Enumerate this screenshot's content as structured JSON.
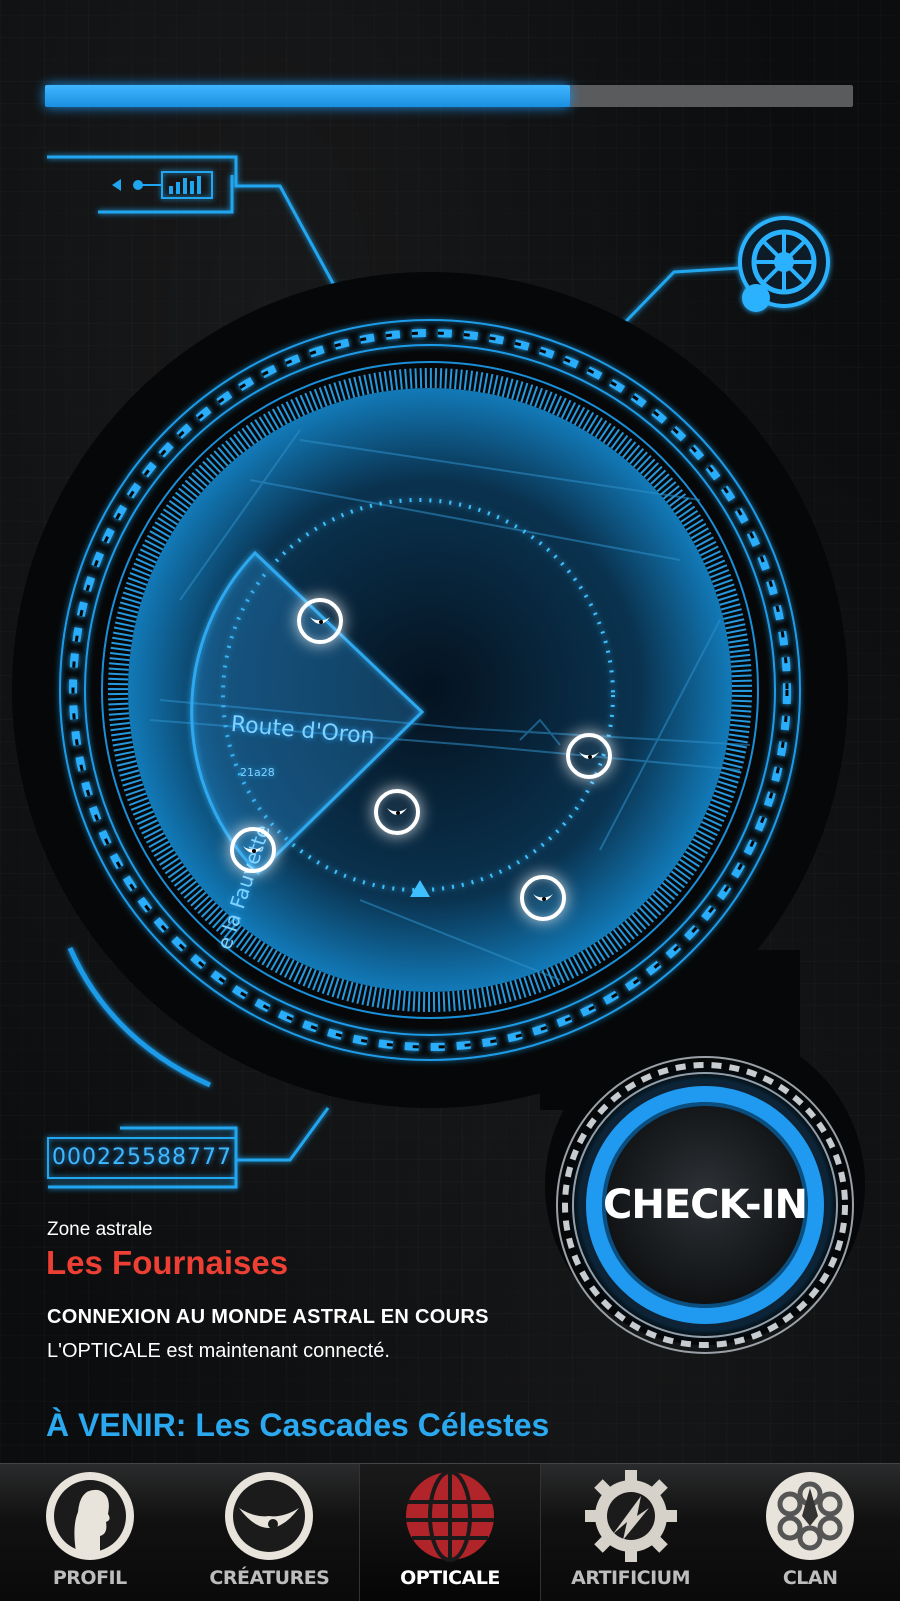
{
  "progress": {
    "value": 0.65
  },
  "map": {
    "road_primary": "Route d'Oron",
    "road_number": "21a28",
    "road_secondary": "e la Fauvette"
  },
  "id_number": "000225588777",
  "zone": {
    "label": "Zone astrale",
    "name": "Les Fournaises"
  },
  "status": {
    "title": "CONNEXION AU MONDE ASTRAL EN COURS",
    "text": "L'OPTICALE est maintenant connecté."
  },
  "upcoming": "À VENIR: Les Cascades Célestes",
  "checkin": {
    "label": "CHECK-IN"
  },
  "tabs": [
    {
      "label": "PROFIL",
      "icon": "profile-icon"
    },
    {
      "label": "CRÉATURES",
      "icon": "creature-eye-icon"
    },
    {
      "label": "OPTICALE",
      "icon": "globe-icon",
      "active": true
    },
    {
      "label": "ARTIFICIUM",
      "icon": "gear-icon"
    },
    {
      "label": "CLAN",
      "icon": "clan-icon"
    }
  ],
  "colors": {
    "accent": "#1f9af0",
    "zone_name": "#ee3f34",
    "upcoming": "#2ba9f0"
  }
}
